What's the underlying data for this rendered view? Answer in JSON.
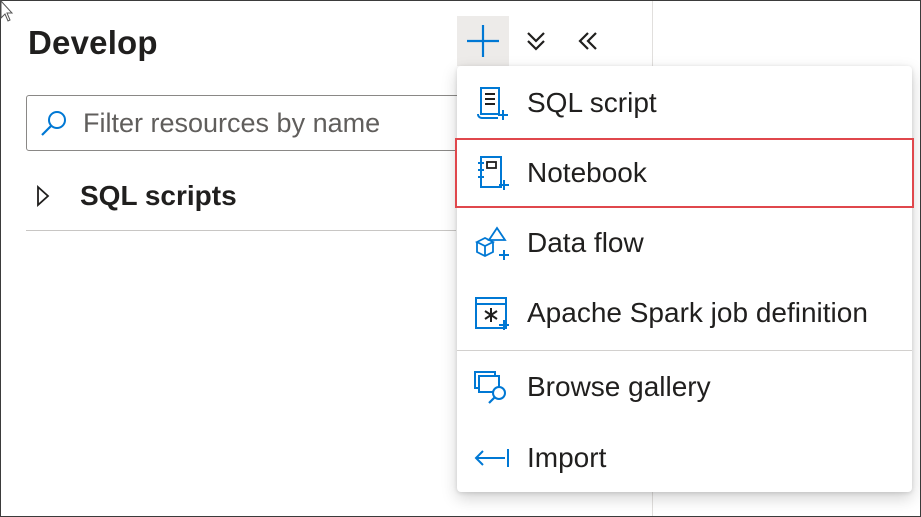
{
  "panel": {
    "title": "Develop"
  },
  "toolbar": {
    "add_icon": "plus-icon",
    "expand_icon": "chevron-double-down-icon",
    "collapse_icon": "chevron-double-left-icon"
  },
  "search": {
    "placeholder": "Filter resources by name",
    "value": "",
    "icon": "search-icon"
  },
  "tree": {
    "items": [
      {
        "label": "SQL scripts",
        "icon": "caret-right-icon",
        "expanded": false
      }
    ]
  },
  "menu": {
    "items": [
      {
        "label": "SQL script",
        "icon": "sql-script-icon",
        "highlighted": false
      },
      {
        "label": "Notebook",
        "icon": "notebook-icon",
        "highlighted": true
      },
      {
        "label": "Data flow",
        "icon": "data-flow-icon",
        "highlighted": false
      },
      {
        "label": "Apache Spark job definition",
        "icon": "spark-job-icon",
        "highlighted": false
      },
      {
        "label": "Browse gallery",
        "icon": "browse-gallery-icon",
        "highlighted": false
      },
      {
        "label": "Import",
        "icon": "import-icon",
        "highlighted": false
      }
    ]
  },
  "colors": {
    "accent": "#0078d4",
    "highlight_outline": "#e0474c",
    "add_button_bg": "#edebe9",
    "text": "#201f1e"
  }
}
